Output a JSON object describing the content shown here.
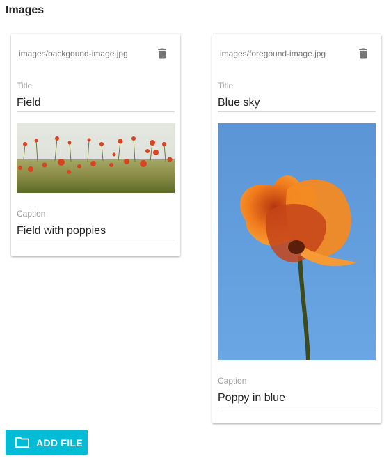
{
  "section": {
    "title": "Images"
  },
  "cards": [
    {
      "filename": "images/backgound-image.jpg",
      "title_label": "Title",
      "title_value": "Field",
      "caption_label": "Caption",
      "caption_value": "Field with poppies",
      "image_name": "poppy-field-photo"
    },
    {
      "filename": "images/foregound-image.jpg",
      "title_label": "Title",
      "title_value": "Blue sky",
      "caption_label": "Caption",
      "caption_value": "Poppy in blue",
      "image_name": "poppy-sky-photo"
    }
  ],
  "actions": {
    "add_file_label": "ADD FILE",
    "icon": "folder-icon"
  },
  "colors": {
    "accent": "#00bcd4",
    "delete_icon": "#757575"
  }
}
